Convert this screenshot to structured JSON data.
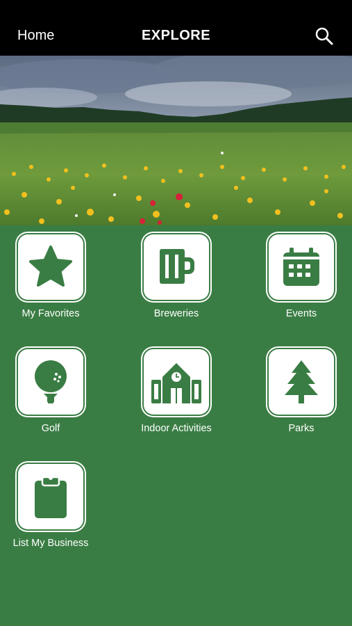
{
  "header": {
    "home_label": "Home",
    "title": "EXPLORE",
    "search_icon": "search-icon"
  },
  "hero": {
    "image": "wildflower-meadow-photo"
  },
  "tiles": [
    {
      "label": "My Favorites",
      "icon": "star-icon"
    },
    {
      "label": "Breweries",
      "icon": "beer-mug-icon"
    },
    {
      "label": "Events",
      "icon": "calendar-icon"
    },
    {
      "label": "Golf",
      "icon": "golf-ball-icon"
    },
    {
      "label": "Indoor Activities",
      "icon": "building-icon"
    },
    {
      "label": "Parks",
      "icon": "pine-tree-icon"
    },
    {
      "label": "List My Business",
      "icon": "clipboard-icon"
    }
  ],
  "colors": {
    "background": "#3a7d44",
    "header": "#000000",
    "tile": "#ffffff",
    "icon": "#3a7d44"
  }
}
